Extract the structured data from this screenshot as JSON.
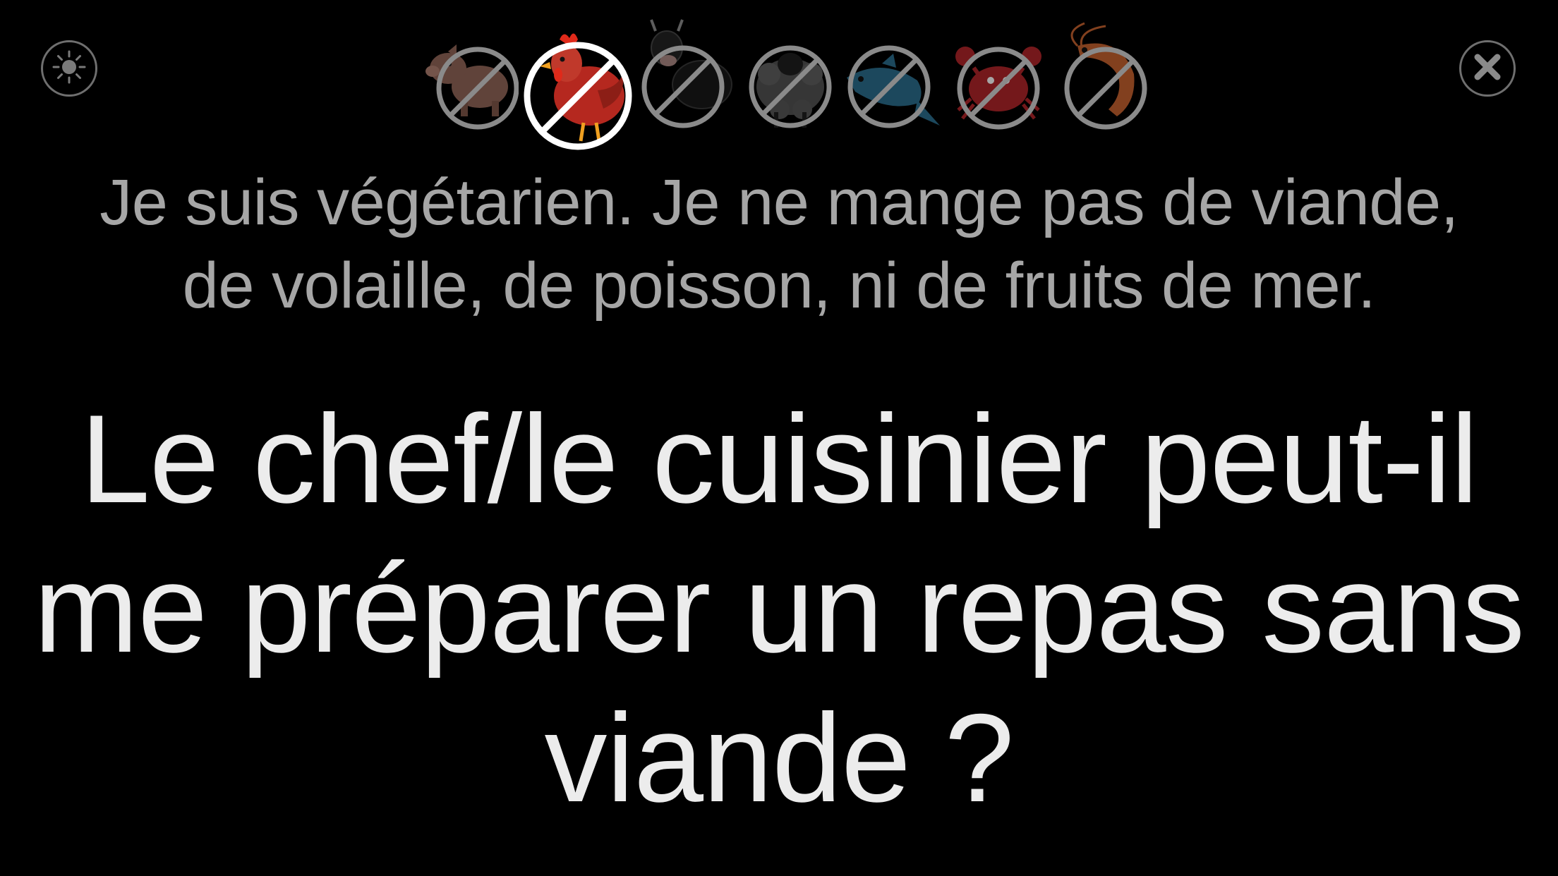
{
  "controls": {
    "brightness_icon": "sun-icon",
    "close_icon": "close-icon"
  },
  "diet_icons": [
    {
      "name": "pig",
      "selected": false,
      "color": "#b07a6a"
    },
    {
      "name": "chicken",
      "selected": true,
      "color": "#c0392b"
    },
    {
      "name": "cow",
      "selected": false,
      "color": "#2a2a2a"
    },
    {
      "name": "sheep",
      "selected": false,
      "color": "#5a5a5a"
    },
    {
      "name": "fish",
      "selected": false,
      "color": "#2b6f8f"
    },
    {
      "name": "crab",
      "selected": false,
      "color": "#b3262a"
    },
    {
      "name": "shrimp",
      "selected": false,
      "color": "#c8632f"
    }
  ],
  "subtitle": {
    "line1": "Je suis végétarien. Je ne mange pas de viande,",
    "line2": "de volaille, de poisson, ni de fruits de mer."
  },
  "question": {
    "line1": "Le chef/le cuisinier peut-il",
    "line2": "me préparer un repas sans",
    "line3": "viande ?"
  },
  "colors": {
    "background": "#000000",
    "subtitle_text": "#a6a6a6",
    "main_text": "#ececec",
    "ring_inactive": "#8a8a8a",
    "ring_active": "#ffffff"
  }
}
